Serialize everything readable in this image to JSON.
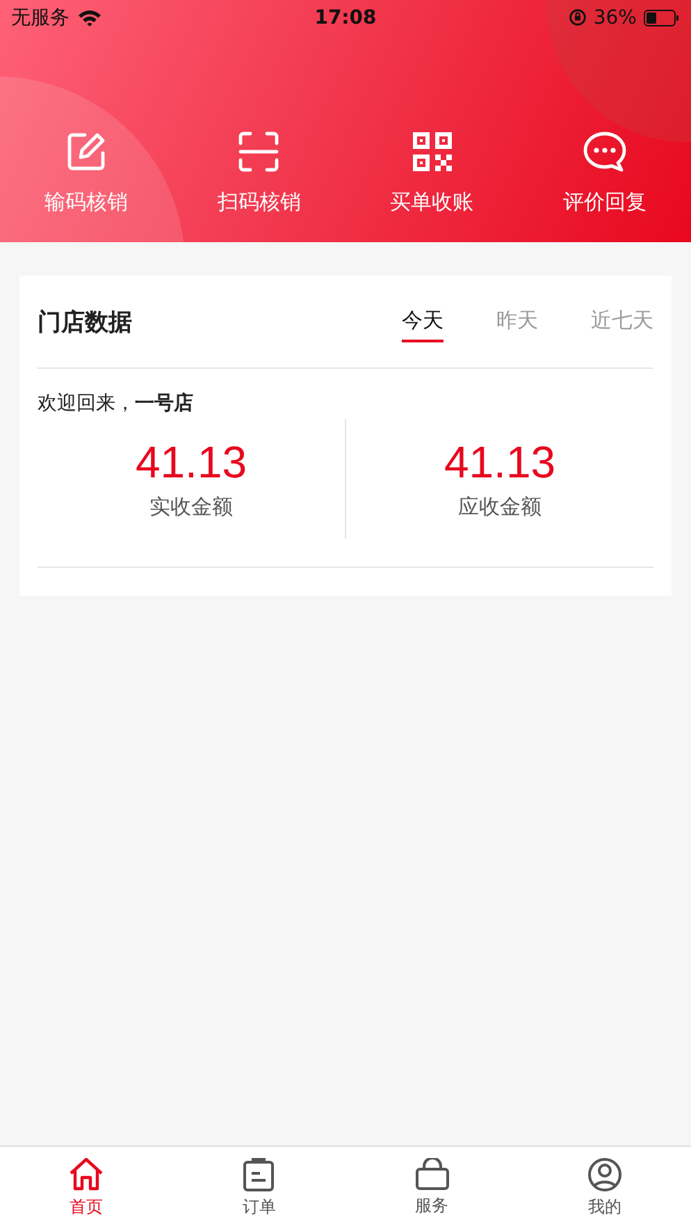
{
  "status_bar": {
    "carrier": "无服务",
    "time": "17:08",
    "battery": "36%"
  },
  "actions": [
    {
      "kind": "edit",
      "label": "输码核销"
    },
    {
      "kind": "scan",
      "label": "扫码核销"
    },
    {
      "kind": "qr",
      "label": "买单收账"
    },
    {
      "kind": "chat",
      "label": "评价回复"
    }
  ],
  "store_data": {
    "title": "门店数据",
    "tabs": [
      {
        "label": "今天",
        "selected": true
      },
      {
        "label": "昨天",
        "selected": false
      },
      {
        "label": "近七天",
        "selected": false
      }
    ],
    "welcome": "欢迎回来，**一号店**",
    "stats": [
      {
        "value": "41.13",
        "label": "实收金额"
      },
      {
        "value": "41.13",
        "label": "应收金额"
      }
    ]
  },
  "tab_bar": [
    {
      "kind": "home",
      "label": "首页",
      "selected": true
    },
    {
      "kind": "order",
      "label": "订单",
      "selected": false
    },
    {
      "kind": "service",
      "label": "服务",
      "selected": false
    },
    {
      "kind": "mine",
      "label": "我的",
      "selected": false
    }
  ]
}
